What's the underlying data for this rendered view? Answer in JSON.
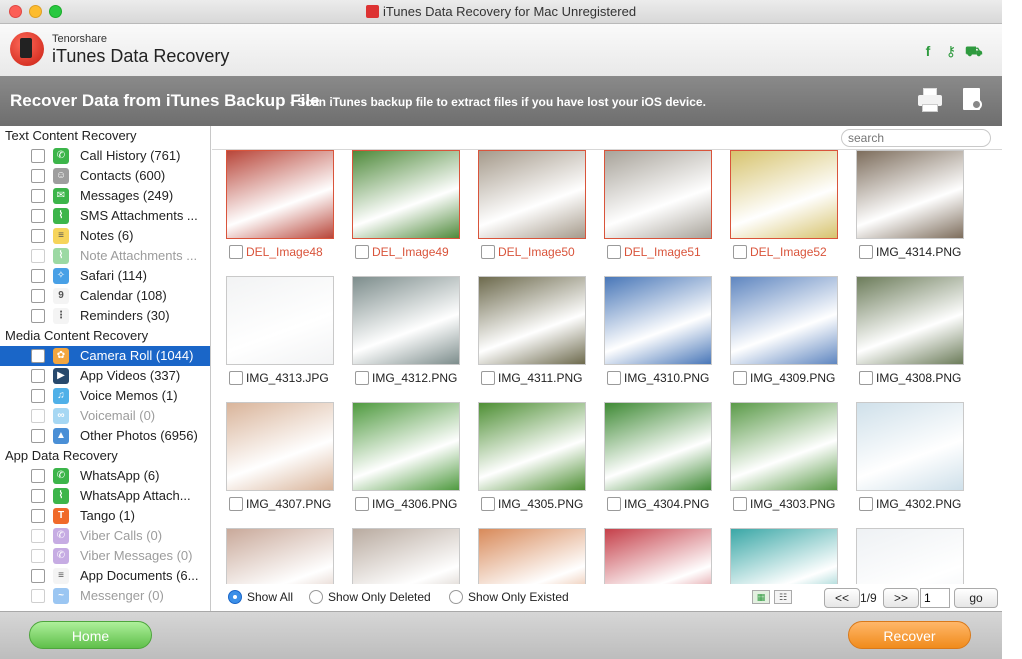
{
  "window": {
    "title": "iTunes Data Recovery for Mac Unregistered"
  },
  "header": {
    "brand": "Tenorshare",
    "app_name": "iTunes Data Recovery",
    "icons": [
      "facebook-icon",
      "key-icon",
      "cart-icon"
    ]
  },
  "banner": {
    "title": "Recover Data from iTunes Backup File",
    "subtitle": "- Scan iTunes backup file to extract files if you have lost your iOS device."
  },
  "sidebar": {
    "sections": [
      {
        "title": "Text Content Recovery",
        "items": [
          {
            "label": "Call History (761)",
            "icon": "phone-icon",
            "color": "#3cb54a",
            "glyph": "✆",
            "disabled": false
          },
          {
            "label": "Contacts (600)",
            "icon": "contacts-icon",
            "color": "#9e9e9e",
            "glyph": "☺",
            "disabled": false
          },
          {
            "label": "Messages (249)",
            "icon": "message-icon",
            "color": "#3cb54a",
            "glyph": "✉",
            "disabled": false
          },
          {
            "label": "SMS Attachments ...",
            "icon": "paperclip-icon",
            "color": "#3cb54a",
            "glyph": "⌇",
            "disabled": false
          },
          {
            "label": "Notes (6)",
            "icon": "notes-icon",
            "color": "#f6d45a",
            "glyph": "≡",
            "disabled": false
          },
          {
            "label": "Note Attachments ...",
            "icon": "paperclip-icon",
            "color": "#3cb54a",
            "glyph": "⌇",
            "disabled": true
          },
          {
            "label": "Safari (114)",
            "icon": "safari-icon",
            "color": "#48a0e6",
            "glyph": "✧",
            "disabled": false
          },
          {
            "label": "Calendar (108)",
            "icon": "calendar-icon",
            "color": "#f4f4f4",
            "glyph": "9",
            "disabled": false
          },
          {
            "label": "Reminders (30)",
            "icon": "reminders-icon",
            "color": "#f4f4f4",
            "glyph": "⋮",
            "disabled": false
          }
        ]
      },
      {
        "title": "Media Content Recovery",
        "items": [
          {
            "label": "Camera Roll (1044)",
            "icon": "photos-icon",
            "color": "#f2a640",
            "glyph": "✿",
            "disabled": false,
            "selected": true
          },
          {
            "label": "App Videos (337)",
            "icon": "video-icon",
            "color": "#27496d",
            "glyph": "▶",
            "disabled": false
          },
          {
            "label": "Voice Memos (1)",
            "icon": "microphone-icon",
            "color": "#4fb0e8",
            "glyph": "♫",
            "disabled": false
          },
          {
            "label": "Voicemail (0)",
            "icon": "voicemail-icon",
            "color": "#4fb0e8",
            "glyph": "∞",
            "disabled": true
          },
          {
            "label": "Other Photos (6956)",
            "icon": "landscape-icon",
            "color": "#4a8fd6",
            "glyph": "▲",
            "disabled": false
          }
        ]
      },
      {
        "title": "App Data Recovery",
        "items": [
          {
            "label": "WhatsApp (6)",
            "icon": "whatsapp-icon",
            "color": "#3cb54a",
            "glyph": "✆",
            "disabled": false
          },
          {
            "label": "WhatsApp Attach...",
            "icon": "paperclip-icon",
            "color": "#3cb54a",
            "glyph": "⌇",
            "disabled": false
          },
          {
            "label": "Tango (1)",
            "icon": "tango-icon",
            "color": "#f06a2a",
            "glyph": "T",
            "disabled": false
          },
          {
            "label": "Viber Calls (0)",
            "icon": "viber-icon",
            "color": "#8e5bc8",
            "glyph": "✆",
            "disabled": true
          },
          {
            "label": "Viber Messages (0)",
            "icon": "viber-icon",
            "color": "#8e5bc8",
            "glyph": "✆",
            "disabled": true
          },
          {
            "label": "App Documents (6...",
            "icon": "document-icon",
            "color": "#f4f4f4",
            "glyph": "≡",
            "disabled": false
          },
          {
            "label": "Messenger (0)",
            "icon": "messenger-icon",
            "color": "#3a8ee6",
            "glyph": "~",
            "disabled": true
          }
        ]
      }
    ]
  },
  "content": {
    "search_placeholder": "search",
    "photos": [
      {
        "name": "DEL_Image48",
        "deleted": true,
        "bg": "#b8463a"
      },
      {
        "name": "DEL_Image49",
        "deleted": true,
        "bg": "#4f8a3b"
      },
      {
        "name": "DEL_Image50",
        "deleted": true,
        "bg": "#a59a8b"
      },
      {
        "name": "DEL_Image51",
        "deleted": true,
        "bg": "#a8a39a"
      },
      {
        "name": "DEL_Image52",
        "deleted": true,
        "bg": "#d7c36e"
      },
      {
        "name": "IMG_4314.PNG",
        "deleted": false,
        "bg": "#7d6d5c"
      },
      {
        "name": "IMG_4313.JPG",
        "deleted": false,
        "bg": "#f2f3f4"
      },
      {
        "name": "IMG_4312.PNG",
        "deleted": false,
        "bg": "#7d8d8c"
      },
      {
        "name": "IMG_4311.PNG",
        "deleted": false,
        "bg": "#6d6a4d"
      },
      {
        "name": "IMG_4310.PNG",
        "deleted": false,
        "bg": "#4977b8"
      },
      {
        "name": "IMG_4309.PNG",
        "deleted": false,
        "bg": "#5f86c0"
      },
      {
        "name": "IMG_4308.PNG",
        "deleted": false,
        "bg": "#6c7c5a"
      },
      {
        "name": "IMG_4307.PNG",
        "deleted": false,
        "bg": "#d9b49a"
      },
      {
        "name": "IMG_4306.PNG",
        "deleted": false,
        "bg": "#4f9a3f"
      },
      {
        "name": "IMG_4305.PNG",
        "deleted": false,
        "bg": "#4e8f34"
      },
      {
        "name": "IMG_4304.PNG",
        "deleted": false,
        "bg": "#3f8a35"
      },
      {
        "name": "IMG_4303.PNG",
        "deleted": false,
        "bg": "#5a9a48"
      },
      {
        "name": "IMG_4302.PNG",
        "deleted": false,
        "bg": "#cfe0ea"
      },
      {
        "name": "",
        "deleted": false,
        "bg": "#c9a99a"
      },
      {
        "name": "",
        "deleted": false,
        "bg": "#b9aba0"
      },
      {
        "name": "",
        "deleted": false,
        "bg": "#d88a5a"
      },
      {
        "name": "",
        "deleted": false,
        "bg": "#c5404a"
      },
      {
        "name": "",
        "deleted": false,
        "bg": "#3aa7a6"
      },
      {
        "name": "",
        "deleted": false,
        "bg": "#eef1f4"
      }
    ],
    "filters": {
      "show_all": "Show All",
      "show_deleted": "Show Only Deleted",
      "show_existed": "Show Only Existed"
    },
    "pagination": {
      "prev_label": "<<",
      "page_info": "1/9",
      "next_label": ">>",
      "page_input": "1",
      "go_label": "go"
    }
  },
  "footer": {
    "home_label": "Home",
    "recover_label": "Recover"
  }
}
